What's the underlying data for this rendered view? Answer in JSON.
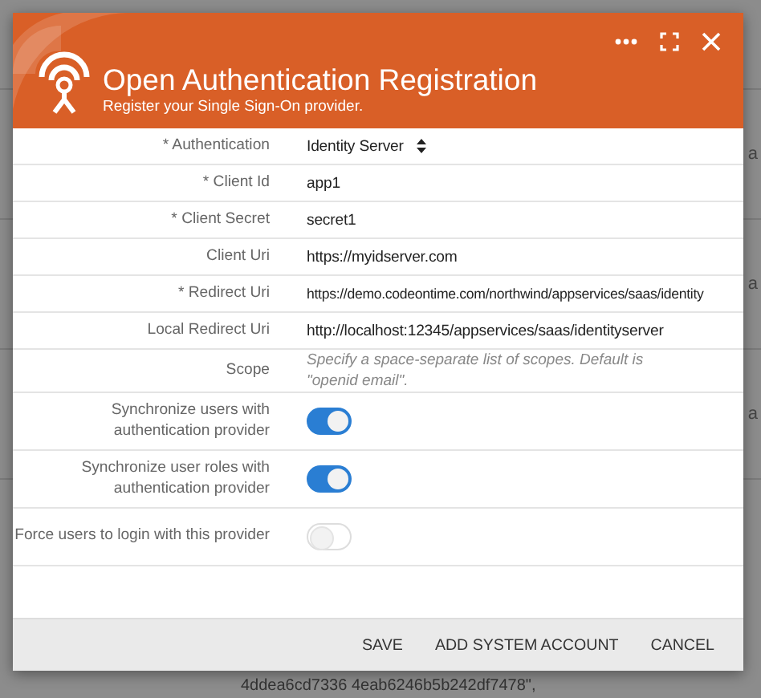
{
  "background": {
    "row_fragments": [
      "a",
      "a",
      "a"
    ],
    "footer_text": "4ddea6cd7336 4eab6246b5b242df7478\","
  },
  "dialog": {
    "title": "Open Authentication Registration",
    "subtitle": "Register your Single Sign-On provider.",
    "fields": [
      {
        "kind": "select",
        "label": "* Authentication",
        "value": "Identity Server"
      },
      {
        "kind": "text",
        "label": "* Client Id",
        "value": "app1"
      },
      {
        "kind": "text",
        "label": "* Client Secret",
        "value": "secret1"
      },
      {
        "kind": "text",
        "label": "Client Uri",
        "value": "https://myidserver.com"
      },
      {
        "kind": "text",
        "label": "* Redirect Uri",
        "value": "https://demo.codeontime.com/northwind/appservices/saas/identity"
      },
      {
        "kind": "text",
        "label": "Local Redirect Uri",
        "value": "http://localhost:12345/appservices/saas/identityserver"
      },
      {
        "kind": "hint",
        "label": "Scope",
        "placeholder": "Specify a space-separate list of scopes. Default is \"openid email\"."
      },
      {
        "kind": "toggle",
        "label": "Synchronize users with authentication provider",
        "on": true
      },
      {
        "kind": "toggle",
        "label": "Synchronize user roles with authentication provider",
        "on": true
      },
      {
        "kind": "toggle",
        "label": "Force users to login with this provider",
        "on": false
      }
    ],
    "buttons": [
      "SAVE",
      "ADD SYSTEM ACCOUNT",
      "CANCEL"
    ]
  }
}
